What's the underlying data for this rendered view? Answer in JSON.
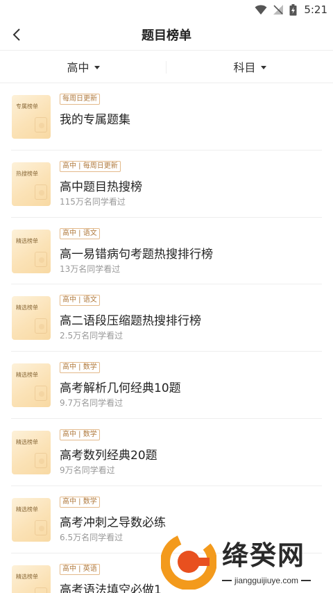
{
  "status_bar": {
    "time": "5:21"
  },
  "nav": {
    "title": "题目榜单"
  },
  "filters": [
    {
      "label": "高中"
    },
    {
      "label": "科目"
    }
  ],
  "items": [
    {
      "cover_label": "专属榜单",
      "tag": "每周日更新",
      "title": "我的专属题集",
      "sub": ""
    },
    {
      "cover_label": "热搜榜单",
      "tag": "高中 | 每周日更新",
      "title": "高中题目热搜榜",
      "sub": "115万名同学看过"
    },
    {
      "cover_label": "精选榜单",
      "tag": "高中 | 语文",
      "title": "高一易错病句考题热搜排行榜",
      "sub": "13万名同学看过"
    },
    {
      "cover_label": "精选榜单",
      "tag": "高中 | 语文",
      "title": "高二语段压缩题热搜排行榜",
      "sub": "2.5万名同学看过"
    },
    {
      "cover_label": "精选榜单",
      "tag": "高中 | 数学",
      "title": "高考解析几何经典10题",
      "sub": "9.7万名同学看过"
    },
    {
      "cover_label": "精选榜单",
      "tag": "高中 | 数学",
      "title": "高考数列经典20题",
      "sub": "9万名同学看过"
    },
    {
      "cover_label": "精选榜单",
      "tag": "高中 | 数学",
      "title": "高考冲刺之导数必练",
      "sub": "6.5万名同学看过"
    },
    {
      "cover_label": "精选榜单",
      "tag": "高中 | 英语",
      "title": "高考语法填空必做1",
      "sub": ""
    }
  ],
  "watermark": {
    "name": "绛癸网",
    "url": "jiangguijiuye.com"
  },
  "colors": {
    "accent_tag": "#b07a3e",
    "tag_border": "#e3b98a",
    "cover": "#fbe2b6"
  }
}
